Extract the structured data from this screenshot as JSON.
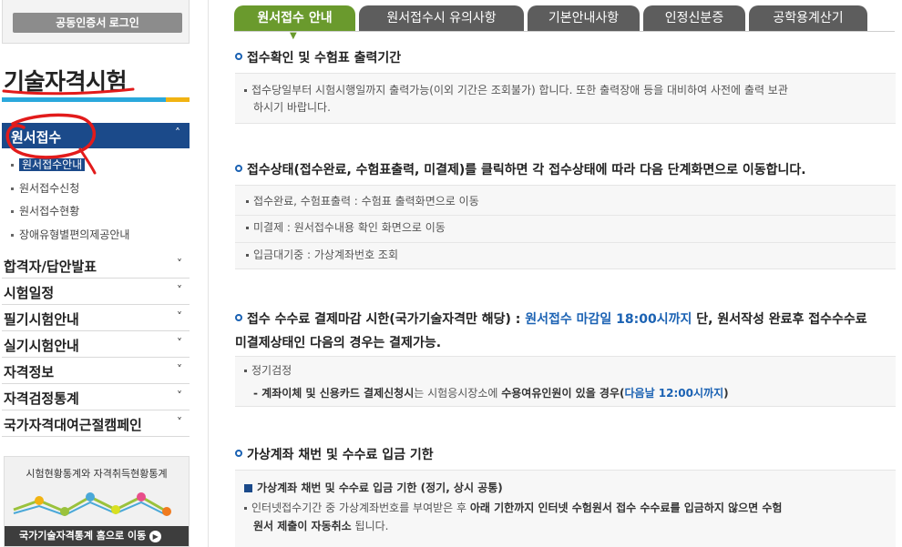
{
  "sidebar": {
    "cert_login": "공동인증서 로그인",
    "title": "기술자격시험",
    "active_menu": "원서접수",
    "sub_items": [
      {
        "label": "원서접수안내",
        "selected": true
      },
      {
        "label": "원서접수신청",
        "selected": false
      },
      {
        "label": "원서접수현황",
        "selected": false
      },
      {
        "label": "장애유형별편의제공안내",
        "selected": false
      }
    ],
    "menu_items": [
      "합격자/답안발표",
      "시험일정",
      "필기시험안내",
      "실기시험안내",
      "자격정보",
      "자격검정통계",
      "국가자격대여근절캠페인"
    ],
    "stats_caption": "시험현황통계와 자격취득현황통계",
    "stats_link": "국가기술자격통계 홈으로 이동",
    "chevron_up": "˄",
    "chevron_down": "˅"
  },
  "tabs": [
    "원서접수 안내",
    "원서접수시 유의사항",
    "기본안내사항",
    "인정신분증",
    "공학용계산기"
  ],
  "sections": {
    "s1": {
      "title": "접수확인 및 수험표 출력기간",
      "line1": "접수당일부터 시험시행일까지 출력가능(이외 기간은 조회불가) 합니다. 또한 출력장애 등을 대비하여 사전에 출력 보관",
      "line2": "하시기 바랍니다."
    },
    "s2": {
      "title": "접수상태(접수완료, 수험표출력, 미결제)를 클릭하면 각 접수상태에 따라 다음 단계화면으로 이동합니다.",
      "items": [
        "접수완료, 수험표출력 : 수험표 출력화면으로 이동",
        "미결제 : 원서접수내용 확인 화면으로 이동",
        "입금대기중 : 가상계좌번호 조회"
      ]
    },
    "s3": {
      "title_a": "접수 수수료 결제마감 시한(국가기술자격만 해당) : ",
      "title_hl": "원서접수 마감일 18:00시까지",
      "title_b": " 단, 원서작성 완료후 접수수수료",
      "title_line2": "미결제상태인 다음의 경우는 결제가능.",
      "item": "정기검정",
      "detail_a": "- 계좌이체 및 신용카드 결제신청시",
      "detail_b": "는 시험응시장소에 ",
      "detail_c": "수용여유인원이 있을 경우(",
      "detail_hl": "다음날 12:00시까지",
      "detail_d": ")"
    },
    "s4": {
      "title": "가상계좌 채번 및 수수료 입금 기한",
      "sub_title": "가상계좌 채번 및 수수료 입금 기한 (정기, 상시 공통)",
      "line1_a": "인터넷접수기간 중 가상계좌번호를 부여받은 후 ",
      "line1_b": "아래 기한까지 인터넷 수험원서 접수 수수료를 입금하지 않으면 수험",
      "line2_a": "원서 제출이 자동취소",
      "line2_b": " 됩니다."
    }
  },
  "colors": {
    "active_tab": "#6a9a2d",
    "tab": "#5d5d5d",
    "menu_active": "#1b4a8a",
    "highlight_blue": "#1b62b3",
    "annotation_red": "#e21b1b"
  }
}
